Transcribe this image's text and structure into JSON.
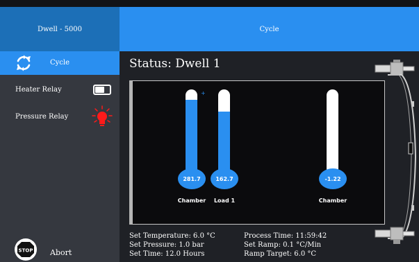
{
  "sidebar": {
    "header": "Dwell - 5000",
    "cycle_label": "Cycle",
    "heater_relay_label": "Heater Relay",
    "pressure_relay_label": "Pressure Relay",
    "abort_label": "Abort",
    "stop_icon_text": "STOP"
  },
  "header": {
    "title": "Cycle"
  },
  "status": "Status: Dwell 1",
  "gauges": [
    {
      "value": "281.7",
      "label": "Chamber",
      "fill": 0.95
    },
    {
      "value": "162.7",
      "label": "Load 1",
      "fill": 0.8
    },
    {
      "value": "-1.22",
      "label": "Chamber",
      "fill": 0.0
    }
  ],
  "info": {
    "set_temperature": "Set Temperature: 6.0 °C",
    "set_pressure": "Set Pressure: 1.0 bar",
    "set_time": "Set Time: 12.0 Hours",
    "process_time": "Process Time: 11:59:42",
    "set_ramp": "Set Ramp: 0.1 °C/Min",
    "ramp_target": "Ramp Target: 6.0 °C"
  },
  "colors": {
    "accent": "#2a8ff0",
    "sidebar": "#35383f",
    "header_dark": "#1c6fb7",
    "relay_on": "#ff1a1a"
  }
}
